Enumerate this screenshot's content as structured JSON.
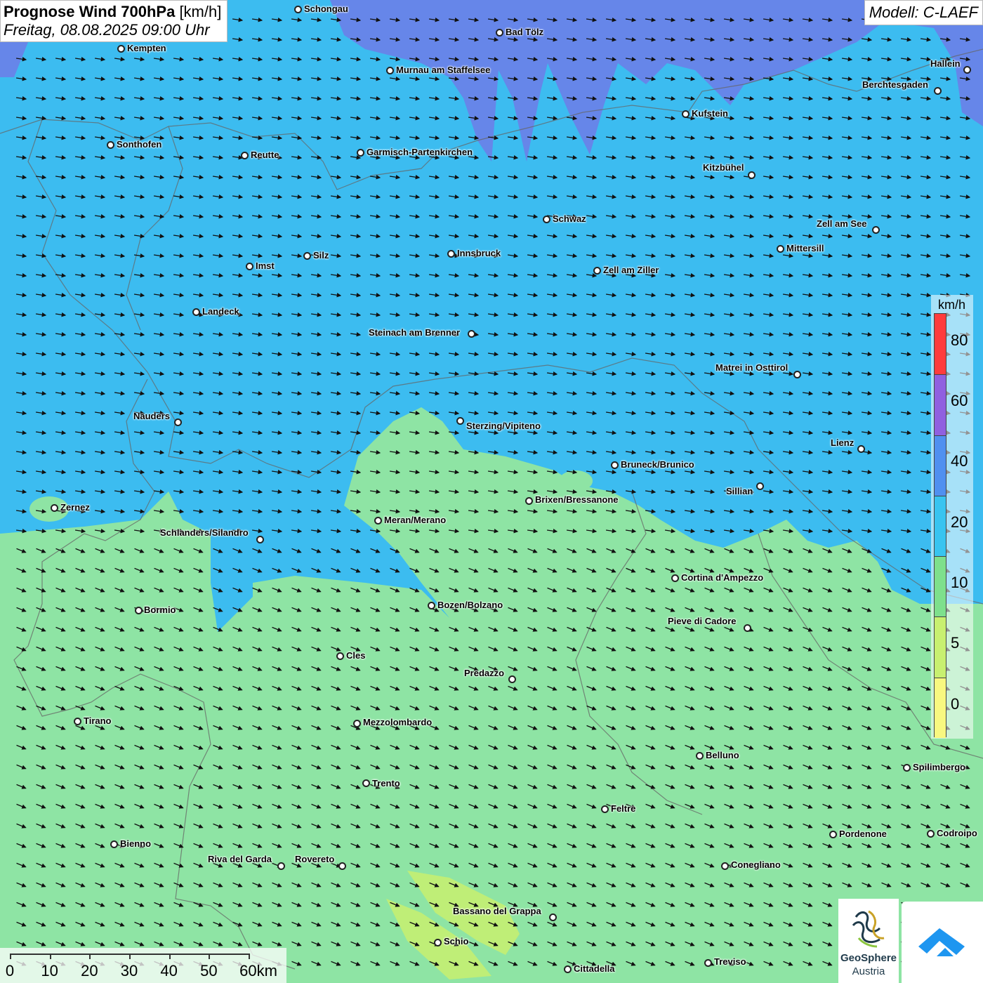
{
  "title": {
    "bold": "Prognose Wind 700hPa",
    "unit": "[km/h]",
    "subtitle": "Freitag, 08.08.2025 09:00 Uhr"
  },
  "model": "Modell: C-LAEF",
  "legend": {
    "unit": "km/h",
    "labels": [
      "80",
      "60",
      "40",
      "20",
      "10",
      "5",
      "0"
    ],
    "colors": [
      "#ff3c3c",
      "#9060e0",
      "#5090f0",
      "#38c4f0",
      "#7ee08c",
      "#c8f070",
      "#f8f880"
    ]
  },
  "map_colors": {
    "fast": "#3cbcf0",
    "medium": "#8ee4a4",
    "purple": "#6a80e8"
  },
  "cities": [
    {
      "name": "Schongau"
    },
    {
      "name": "Bad Tölz"
    },
    {
      "name": "Kempten"
    },
    {
      "name": "Murnau am Staffelsee"
    },
    {
      "name": "Hallein"
    },
    {
      "name": "Berchtesgaden"
    },
    {
      "name": "Kufstein"
    },
    {
      "name": "Sonthofen"
    },
    {
      "name": "Reutte"
    },
    {
      "name": "Garmisch-Partenkirchen"
    },
    {
      "name": "Kitzbühel"
    },
    {
      "name": "Schwaz"
    },
    {
      "name": "Zell am See"
    },
    {
      "name": "Mittersill"
    },
    {
      "name": "Silz"
    },
    {
      "name": "Innsbruck"
    },
    {
      "name": "Imst"
    },
    {
      "name": "Zell am Ziller"
    },
    {
      "name": "Landeck"
    },
    {
      "name": "Steinach am Brenner"
    },
    {
      "name": "Matrei in Osttirol"
    },
    {
      "name": "Nauders"
    },
    {
      "name": "Sterzing/Vipiteno"
    },
    {
      "name": "Lienz"
    },
    {
      "name": "Bruneck/Brunico"
    },
    {
      "name": "Sillian"
    },
    {
      "name": "Zernez"
    },
    {
      "name": "Brixen/Bressanone"
    },
    {
      "name": "Meran/Merano"
    },
    {
      "name": "Schlanders/Silandro"
    },
    {
      "name": "Cortina d'Ampezzo"
    },
    {
      "name": "Bozen/Bolzano"
    },
    {
      "name": "Bormio"
    },
    {
      "name": "Pieve di Cadore"
    },
    {
      "name": "Cles"
    },
    {
      "name": "Predazzo"
    },
    {
      "name": "Tirano"
    },
    {
      "name": "Mezzolombardo"
    },
    {
      "name": "Belluno"
    },
    {
      "name": "Spilimbergo"
    },
    {
      "name": "Trento"
    },
    {
      "name": "Feltre"
    },
    {
      "name": "Bienno"
    },
    {
      "name": "Pordenone"
    },
    {
      "name": "Codroipo"
    },
    {
      "name": "Riva del Garda"
    },
    {
      "name": "Rovereto"
    },
    {
      "name": "Conegliano"
    },
    {
      "name": "Bassano del Grappa"
    },
    {
      "name": "Schio"
    },
    {
      "name": "Treviso"
    },
    {
      "name": "Cittadella"
    }
  ],
  "scale": {
    "labels": [
      "0",
      "10",
      "20",
      "30",
      "40",
      "50",
      "60km"
    ]
  },
  "logo": {
    "name": "GeoSphere",
    "sub": "Austria"
  }
}
